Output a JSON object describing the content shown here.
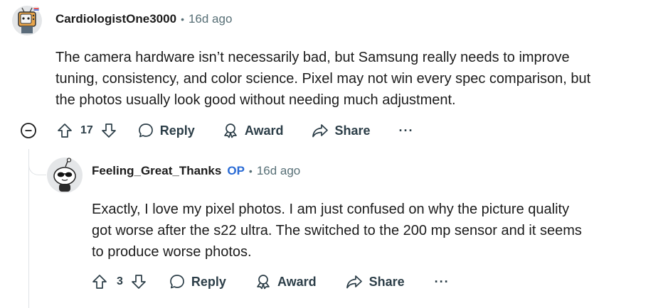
{
  "comment": {
    "author": "CardiologistOne3000",
    "timestamp": "16d ago",
    "separator": "•",
    "body_lines": [
      "The camera hardware isn’t necessarily bad, but Samsung really needs to improve",
      "tuning, consistency, and color science. Pixel may not win every spec comparison, but",
      "the photos usually look good without needing much adjustment."
    ],
    "votes": "17",
    "actions": {
      "reply": "Reply",
      "award": "Award",
      "share": "Share",
      "more": "···"
    }
  },
  "reply": {
    "author": "Feeling_Great_Thanks",
    "op_badge": "OP",
    "timestamp": "16d ago",
    "separator": "•",
    "body_lines": [
      "Exactly, I love my pixel photos. I am just confused on why the picture quality",
      "got worse after the s22 ultra. The switched to the 200 mp sensor and it seems",
      "to produce worse photos."
    ],
    "votes": "3",
    "actions": {
      "reply": "Reply",
      "award": "Award",
      "share": "Share",
      "more": "···"
    }
  },
  "colors": {
    "text": "#1c1c1c",
    "meta": "#576f76",
    "action": "#2c3e48",
    "op": "#2a6bd5",
    "thread_line": "#e0e3e6"
  }
}
